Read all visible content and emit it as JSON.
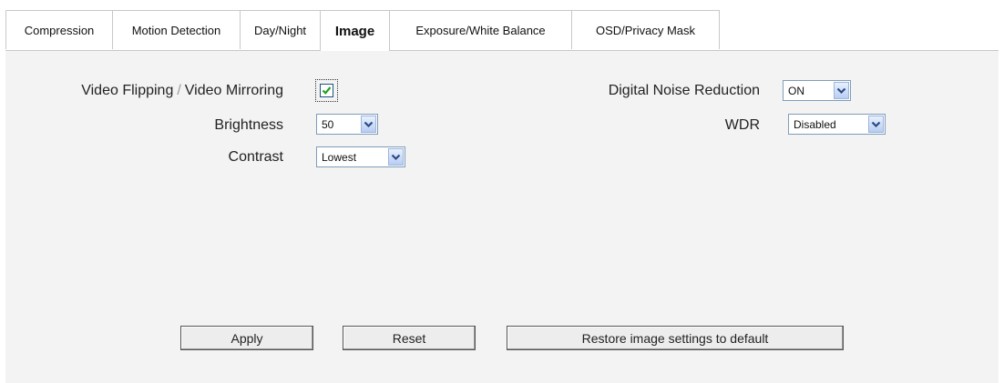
{
  "tabs": [
    {
      "label": "Compression"
    },
    {
      "label": "Motion Detection"
    },
    {
      "label": "Day/Night"
    },
    {
      "label": "Image"
    },
    {
      "label": "Exposure/White Balance"
    },
    {
      "label": "OSD/Privacy Mask"
    }
  ],
  "active_tab": "Image",
  "left": {
    "flip_label": "Video Flipping",
    "separator": "/",
    "mirror_label": "Video Mirroring",
    "flip_mirror_checked": true,
    "brightness_label": "Brightness",
    "brightness_value": "50",
    "contrast_label": "Contrast",
    "contrast_value": "Lowest"
  },
  "right": {
    "dnr_label": "Digital Noise Reduction",
    "dnr_value": "ON",
    "wdr_label": "WDR",
    "wdr_value": "Disabled"
  },
  "buttons": {
    "apply": "Apply",
    "reset": "Reset",
    "restore": "Restore image settings to default"
  },
  "colors": {
    "panel_bg": "#f3f3f3",
    "check": "#21a121"
  }
}
